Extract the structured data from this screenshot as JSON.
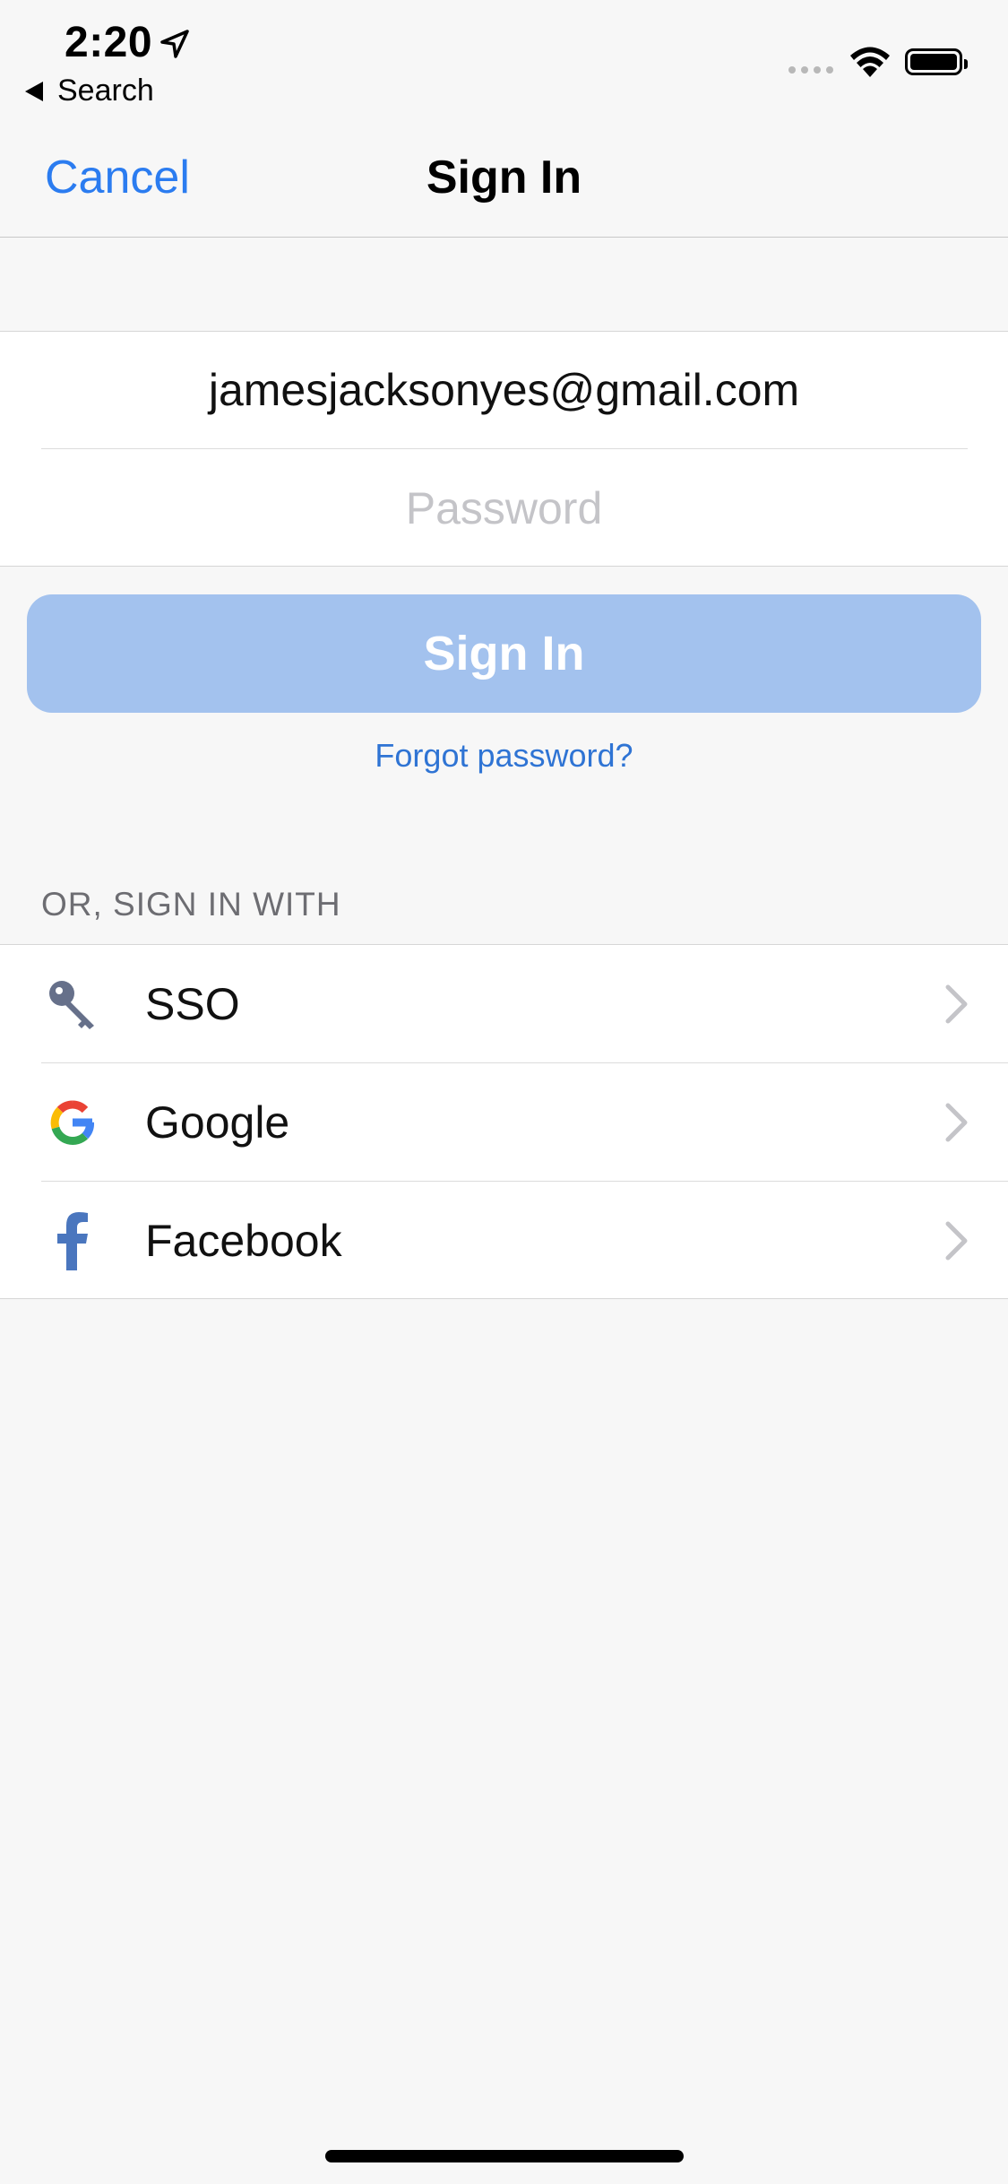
{
  "status_bar": {
    "time": "2:20",
    "back_label": "Search"
  },
  "nav": {
    "cancel_label": "Cancel",
    "title": "Sign In"
  },
  "form": {
    "email_value": "jamesjacksonyes@gmail.com",
    "password_placeholder": "Password"
  },
  "signin_button": {
    "label": "Sign In"
  },
  "forgot_link": {
    "label": "Forgot password?"
  },
  "providers": {
    "header": "OR, SIGN IN WITH",
    "items": [
      {
        "label": "SSO",
        "icon": "key-icon"
      },
      {
        "label": "Google",
        "icon": "google-logo-icon"
      },
      {
        "label": "Facebook",
        "icon": "facebook-logo-icon"
      }
    ]
  },
  "colors": {
    "accent": "#2b7cf0",
    "link": "#2f74d4",
    "button_disabled": "#a3c2ee",
    "background": "#f7f7f7"
  }
}
